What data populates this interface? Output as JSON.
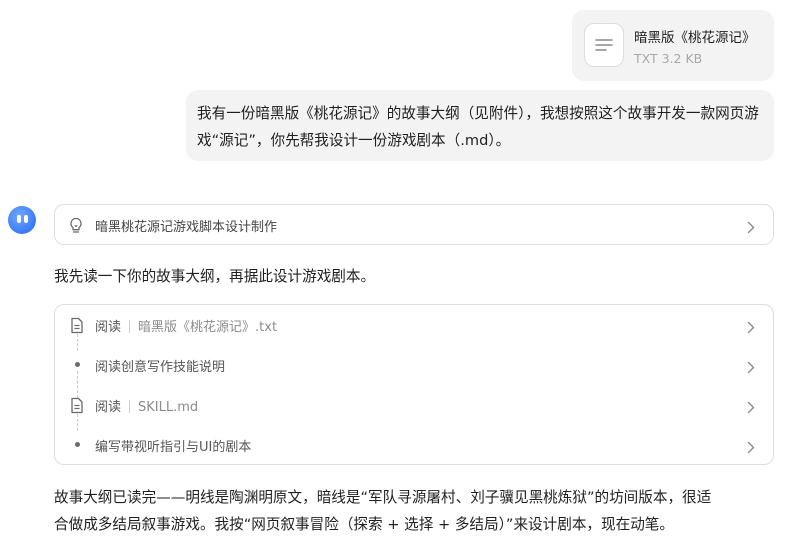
{
  "attachment": {
    "name": "暗黑版《桃花源记》",
    "meta": "TXT 3.2 KB"
  },
  "user_message": "我有一份暗黑版《桃花源记》的故事大纲（见附件），我想按照这个故事开发一款网页游戏“源记”，你先帮我设计一份游戏剧本（.md）。",
  "assistant": {
    "thought_title": "暗黑桃花源记游戏脚本设计制作",
    "intro": "我先读一下你的故事大纲，再据此设计游戏剧本。",
    "steps": [
      {
        "icon": "document-icon",
        "label": "阅读",
        "file": "暗黑版《桃花源记》.txt"
      },
      {
        "icon": "dot",
        "label": "阅读创意写作技能说明",
        "file": ""
      },
      {
        "icon": "document-icon",
        "label": "阅读",
        "file": "SKILL.md"
      },
      {
        "icon": "dot",
        "label": "编写带视听指引与UI的剧本",
        "file": ""
      }
    ],
    "paragraph_line1": "故事大纲已读完——明线是陶渊明原文，暗线是“军队寻源屠村、刘子骥见黑桃炼狱”的坊间版本，很适",
    "paragraph_line2": "合做成多结局叙事游戏。我按“网页叙事冒险（探索 + 选择 + 多结局）”来设计剧本，现在动笔。"
  },
  "colors": {
    "bubble_bg": "#f3f3f4",
    "border": "#dedede",
    "avatar": "#3b7af5",
    "muted_text": "#a8a8a8"
  }
}
